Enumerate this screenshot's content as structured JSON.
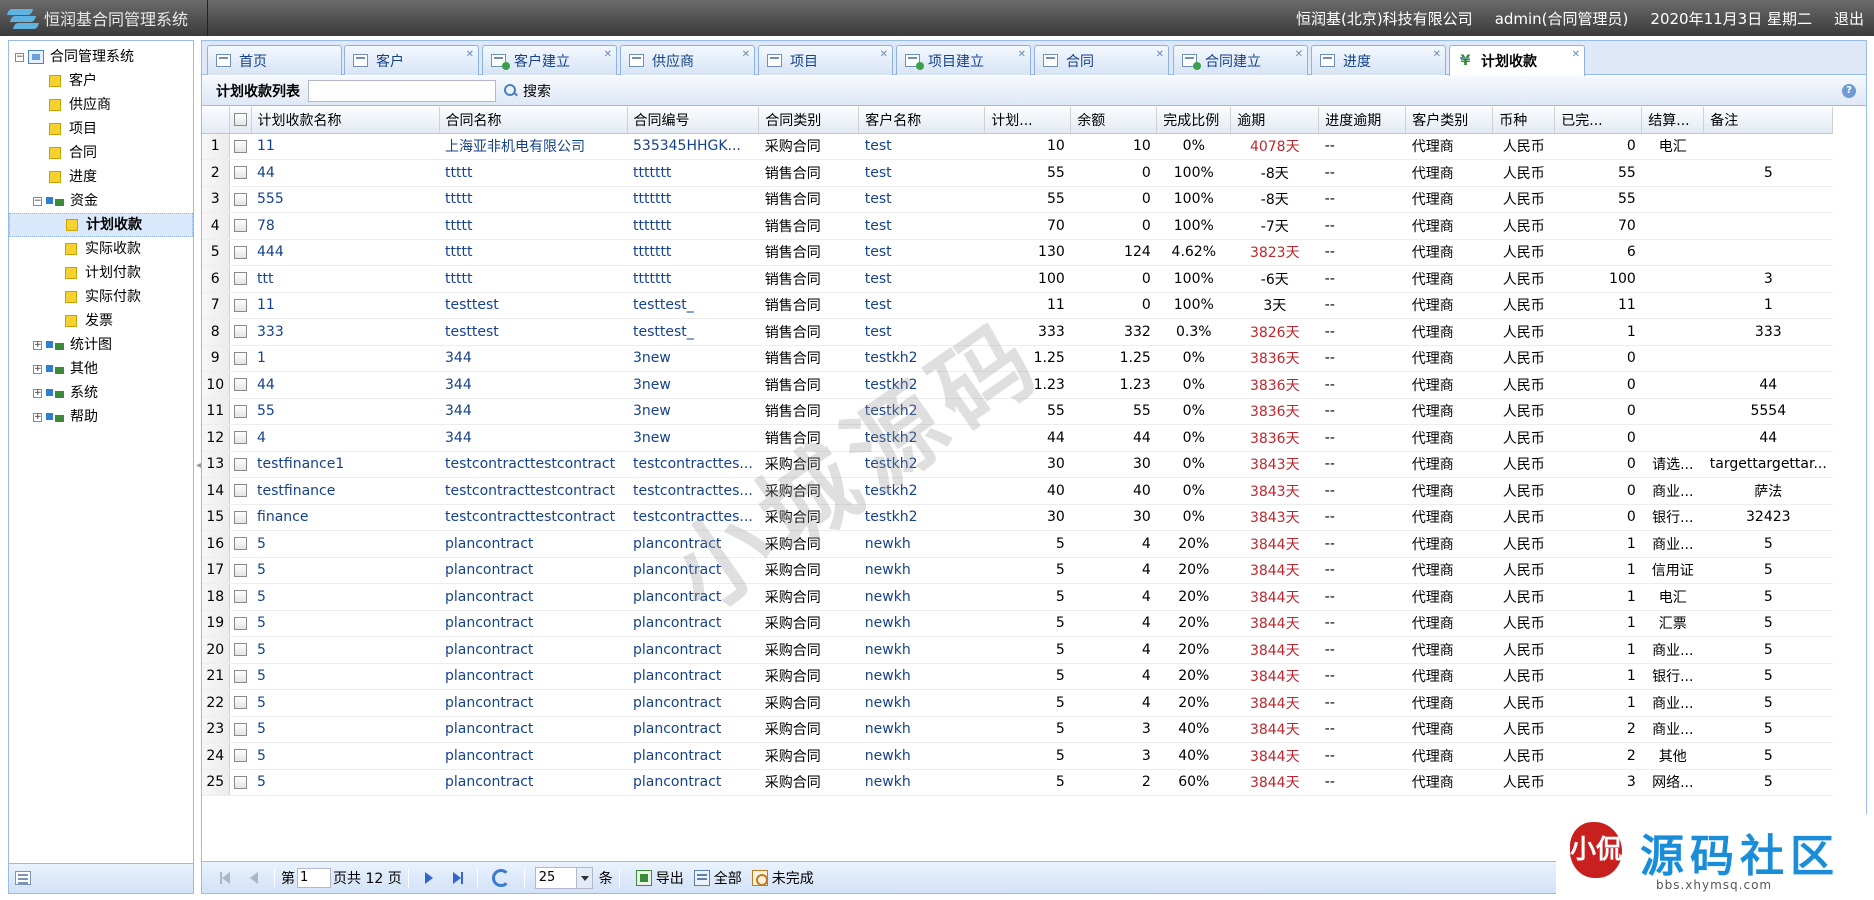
{
  "app": {
    "title": "恒润基合同管理系统"
  },
  "header": {
    "company": "恒润基(北京)科技有限公司",
    "user": "admin(合同管理员)",
    "date": "2020年11月3日 星期二",
    "logout": "退出"
  },
  "tree": {
    "root": "合同管理系统",
    "items": [
      {
        "label": "客户",
        "level": 1,
        "type": "leaf"
      },
      {
        "label": "供应商",
        "level": 1,
        "type": "leaf"
      },
      {
        "label": "项目",
        "level": 1,
        "type": "leaf"
      },
      {
        "label": "合同",
        "level": 1,
        "type": "leaf"
      },
      {
        "label": "进度",
        "level": 1,
        "type": "leaf"
      },
      {
        "label": "资金",
        "level": 1,
        "type": "folder",
        "toggle": "−"
      },
      {
        "label": "计划收款",
        "level": 2,
        "type": "leaf",
        "selected": true
      },
      {
        "label": "实际收款",
        "level": 2,
        "type": "leaf"
      },
      {
        "label": "计划付款",
        "level": 2,
        "type": "leaf"
      },
      {
        "label": "实际付款",
        "level": 2,
        "type": "leaf"
      },
      {
        "label": "发票",
        "level": 2,
        "type": "leaf"
      },
      {
        "label": "统计图",
        "level": 1,
        "type": "folder",
        "toggle": "+"
      },
      {
        "label": "其他",
        "level": 1,
        "type": "folder",
        "toggle": "+"
      },
      {
        "label": "系统",
        "level": 1,
        "type": "folder",
        "toggle": "+"
      },
      {
        "label": "帮助",
        "level": 1,
        "type": "folder",
        "toggle": "+"
      }
    ]
  },
  "tabs": [
    {
      "label": "首页",
      "icon": "page-icon",
      "closable": false
    },
    {
      "label": "客户",
      "icon": "page-icon",
      "closable": true
    },
    {
      "label": "客户建立",
      "icon": "page-add-icon",
      "closable": true
    },
    {
      "label": "供应商",
      "icon": "page-icon",
      "closable": true
    },
    {
      "label": "项目",
      "icon": "page-icon",
      "closable": true
    },
    {
      "label": "项目建立",
      "icon": "page-add-icon",
      "closable": true
    },
    {
      "label": "合同",
      "icon": "page-icon",
      "closable": true
    },
    {
      "label": "合同建立",
      "icon": "page-add-icon",
      "closable": true
    },
    {
      "label": "进度",
      "icon": "page-icon",
      "closable": true
    },
    {
      "label": "计划收款",
      "icon": "yen-icon",
      "closable": true,
      "active": true
    }
  ],
  "panel": {
    "title": "计划收款列表",
    "search_value": "",
    "search_label": "搜索"
  },
  "grid": {
    "columns": [
      "计划收款名称",
      "合同名称",
      "合同编号",
      "合同类别",
      "客户名称",
      "计划...",
      "余额",
      "完成比例",
      "逾期",
      "进度逾期",
      "客户类别",
      "币种",
      "已完...",
      "结算...",
      "备注"
    ],
    "rows": [
      [
        "1",
        "11",
        "上海亚非机电有限公司",
        "535345HHGK...",
        "采购合同",
        "test",
        "10",
        "10",
        "0%",
        "4078天",
        "--",
        "代理商",
        "人民币",
        "0",
        "电汇",
        ""
      ],
      [
        "2",
        "44",
        "ttttt",
        "ttttttt",
        "销售合同",
        "test",
        "55",
        "0",
        "100%",
        "-8天",
        "--",
        "代理商",
        "人民币",
        "55",
        "",
        "5"
      ],
      [
        "3",
        "555",
        "ttttt",
        "ttttttt",
        "销售合同",
        "test",
        "55",
        "0",
        "100%",
        "-8天",
        "--",
        "代理商",
        "人民币",
        "55",
        "",
        ""
      ],
      [
        "4",
        "78",
        "ttttt",
        "ttttttt",
        "销售合同",
        "test",
        "70",
        "0",
        "100%",
        "-7天",
        "--",
        "代理商",
        "人民币",
        "70",
        "",
        ""
      ],
      [
        "5",
        "444",
        "ttttt",
        "ttttttt",
        "销售合同",
        "test",
        "130",
        "124",
        "4.62%",
        "3823天",
        "--",
        "代理商",
        "人民币",
        "6",
        "",
        ""
      ],
      [
        "6",
        "ttt",
        "ttttt",
        "ttttttt",
        "销售合同",
        "test",
        "100",
        "0",
        "100%",
        "-6天",
        "--",
        "代理商",
        "人民币",
        "100",
        "",
        "3"
      ],
      [
        "7",
        "11",
        "testtest",
        "testtest_",
        "销售合同",
        "test",
        "11",
        "0",
        "100%",
        "3天",
        "--",
        "代理商",
        "人民币",
        "11",
        "",
        "1"
      ],
      [
        "8",
        "333",
        "testtest",
        "testtest_",
        "销售合同",
        "test",
        "333",
        "332",
        "0.3%",
        "3826天",
        "--",
        "代理商",
        "人民币",
        "1",
        "",
        "333"
      ],
      [
        "9",
        "1",
        "344",
        "3new",
        "销售合同",
        "testkh2",
        "1.25",
        "1.25",
        "0%",
        "3836天",
        "--",
        "代理商",
        "人民币",
        "0",
        "",
        ""
      ],
      [
        "10",
        "44",
        "344",
        "3new",
        "销售合同",
        "testkh2",
        "1.23",
        "1.23",
        "0%",
        "3836天",
        "--",
        "代理商",
        "人民币",
        "0",
        "",
        "44"
      ],
      [
        "11",
        "55",
        "344",
        "3new",
        "销售合同",
        "testkh2",
        "55",
        "55",
        "0%",
        "3836天",
        "--",
        "代理商",
        "人民币",
        "0",
        "",
        "5554"
      ],
      [
        "12",
        "4",
        "344",
        "3new",
        "销售合同",
        "testkh2",
        "44",
        "44",
        "0%",
        "3836天",
        "--",
        "代理商",
        "人民币",
        "0",
        "",
        "44"
      ],
      [
        "13",
        "testfinance1",
        "testcontracttestcontract",
        "testcontracttes...",
        "采购合同",
        "testkh2",
        "30",
        "30",
        "0%",
        "3843天",
        "--",
        "代理商",
        "人民币",
        "0",
        "请选...",
        "targettargettar..."
      ],
      [
        "14",
        "testfinance",
        "testcontracttestcontract",
        "testcontracttes...",
        "采购合同",
        "testkh2",
        "40",
        "40",
        "0%",
        "3843天",
        "--",
        "代理商",
        "人民币",
        "0",
        "商业...",
        "萨法"
      ],
      [
        "15",
        "finance",
        "testcontracttestcontract",
        "testcontracttes...",
        "采购合同",
        "testkh2",
        "30",
        "30",
        "0%",
        "3843天",
        "--",
        "代理商",
        "人民币",
        "0",
        "银行...",
        "32423"
      ],
      [
        "16",
        "5",
        "plancontract",
        "plancontract",
        "采购合同",
        "newkh",
        "5",
        "4",
        "20%",
        "3844天",
        "--",
        "代理商",
        "人民币",
        "1",
        "商业...",
        "5"
      ],
      [
        "17",
        "5",
        "plancontract",
        "plancontract",
        "采购合同",
        "newkh",
        "5",
        "4",
        "20%",
        "3844天",
        "--",
        "代理商",
        "人民币",
        "1",
        "信用证",
        "5"
      ],
      [
        "18",
        "5",
        "plancontract",
        "plancontract",
        "采购合同",
        "newkh",
        "5",
        "4",
        "20%",
        "3844天",
        "--",
        "代理商",
        "人民币",
        "1",
        "电汇",
        "5"
      ],
      [
        "19",
        "5",
        "plancontract",
        "plancontract",
        "采购合同",
        "newkh",
        "5",
        "4",
        "20%",
        "3844天",
        "--",
        "代理商",
        "人民币",
        "1",
        "汇票",
        "5"
      ],
      [
        "20",
        "5",
        "plancontract",
        "plancontract",
        "采购合同",
        "newkh",
        "5",
        "4",
        "20%",
        "3844天",
        "--",
        "代理商",
        "人民币",
        "1",
        "商业...",
        "5"
      ],
      [
        "21",
        "5",
        "plancontract",
        "plancontract",
        "采购合同",
        "newkh",
        "5",
        "4",
        "20%",
        "3844天",
        "--",
        "代理商",
        "人民币",
        "1",
        "银行...",
        "5"
      ],
      [
        "22",
        "5",
        "plancontract",
        "plancontract",
        "采购合同",
        "newkh",
        "5",
        "4",
        "20%",
        "3844天",
        "--",
        "代理商",
        "人民币",
        "1",
        "商业...",
        "5"
      ],
      [
        "23",
        "5",
        "plancontract",
        "plancontract",
        "采购合同",
        "newkh",
        "5",
        "3",
        "40%",
        "3844天",
        "--",
        "代理商",
        "人民币",
        "2",
        "商业...",
        "5"
      ],
      [
        "24",
        "5",
        "plancontract",
        "plancontract",
        "采购合同",
        "newkh",
        "5",
        "3",
        "40%",
        "3844天",
        "--",
        "代理商",
        "人民币",
        "2",
        "其他",
        "5"
      ],
      [
        "25",
        "5",
        "plancontract",
        "plancontract",
        "采购合同",
        "newkh",
        "5",
        "2",
        "60%",
        "3844天",
        "--",
        "代理商",
        "人民币",
        "3",
        "网络...",
        "5"
      ]
    ]
  },
  "pager": {
    "page_prefix": "第",
    "page": "1",
    "page_suffix": "页共 12 页",
    "page_size": "25",
    "size_unit": "条",
    "export": "导出",
    "all": "全部",
    "incomplete": "未完成"
  },
  "colors": {
    "accent": "#15428b",
    "overdue": "#c0262d",
    "border": "#99bbe8"
  },
  "watermark": {
    "text": "小城源码",
    "brand": "源码社区",
    "brand_url": "bbs.xhymsq.com",
    "seal": "小侃"
  }
}
